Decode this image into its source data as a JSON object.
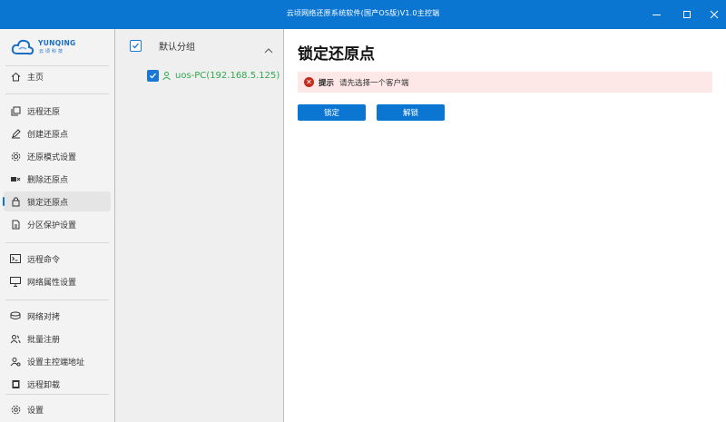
{
  "window": {
    "title": "云顷网络还原系统软件(国产OS版)V1.0主控端"
  },
  "logo": {
    "brand": "YUNQING",
    "sub": "云顷科技"
  },
  "nav": {
    "home": "主页",
    "remote_restore": "远程还原",
    "create_restore_point": "创建还原点",
    "restore_mode": "还原模式设置",
    "delete_restore_point": "删除还原点",
    "lock_restore_point": "锁定还原点",
    "partition_protect": "分区保护设置",
    "remote_command": "远程命令",
    "network_settings": "网络属性设置",
    "network_clone": "网络对拷",
    "batch_register": "批量注册",
    "set_master_address": "设置主控端地址",
    "remote_uninstall": "远程卸载",
    "settings": "设置"
  },
  "group": {
    "name": "默认分组"
  },
  "clients": [
    {
      "label": "uos-PC(192.168.5.125)"
    }
  ],
  "main": {
    "title": "锁定还原点",
    "alert": {
      "keyword": "提示",
      "message": "请先选择一个客户端"
    },
    "lock_button": "锁定",
    "unlock_button": "解锁"
  },
  "colors": {
    "accent": "#0b76d1",
    "online": "#31a84e",
    "error": "#c42b1c",
    "alert_bg": "#fde7e7"
  }
}
